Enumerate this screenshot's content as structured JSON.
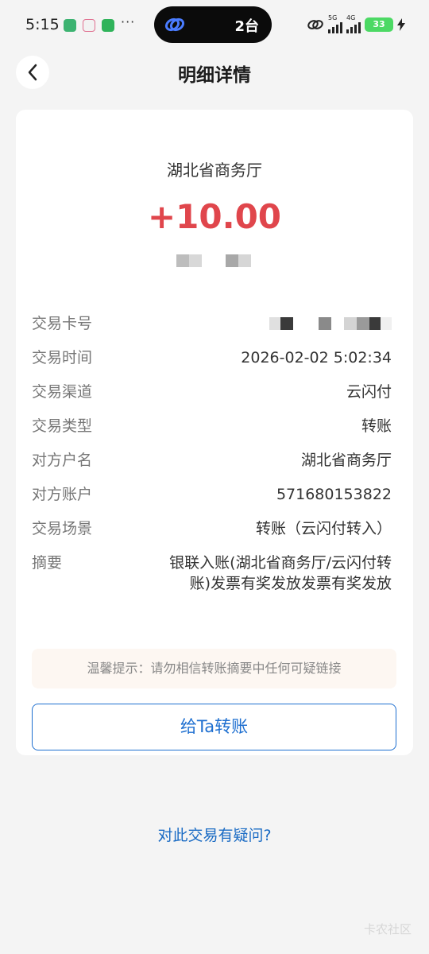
{
  "status_bar": {
    "time": "5:15",
    "dots": "···",
    "island_text": "2台",
    "net1": "5G",
    "net2": "4G",
    "battery": "33"
  },
  "header": {
    "title": "明细详情"
  },
  "detail": {
    "merchant": "湖北省商务厅",
    "amount": "+10.00",
    "rows": [
      {
        "label": "交易卡号",
        "value": ""
      },
      {
        "label": "交易时间",
        "value": "2026-02-02 5:02:34"
      },
      {
        "label": "交易渠道",
        "value": "云闪付"
      },
      {
        "label": "交易类型",
        "value": "转账"
      },
      {
        "label": "对方户名",
        "value": "湖北省商务厅"
      },
      {
        "label": "对方账户",
        "value": "571680153822"
      },
      {
        "label": "交易场景",
        "value": "转账（云闪付转入）"
      },
      {
        "label": "摘要",
        "value": "银联入账(湖北省商务厅/云闪付转账)发票有奖发放发票有奖发放"
      }
    ],
    "tip": "温馨提示：请勿相信转账摘要中任何可疑链接",
    "transfer_button": "给Ta转账"
  },
  "footer": {
    "question_link": "对此交易有疑问?",
    "watermark": "卡农社区"
  },
  "colors": {
    "amount": "#e0464c",
    "accent": "#1e6fd0",
    "background": "#f4f4f4"
  },
  "icons": {
    "back": "chevron-left-icon",
    "island": "link-icon"
  }
}
